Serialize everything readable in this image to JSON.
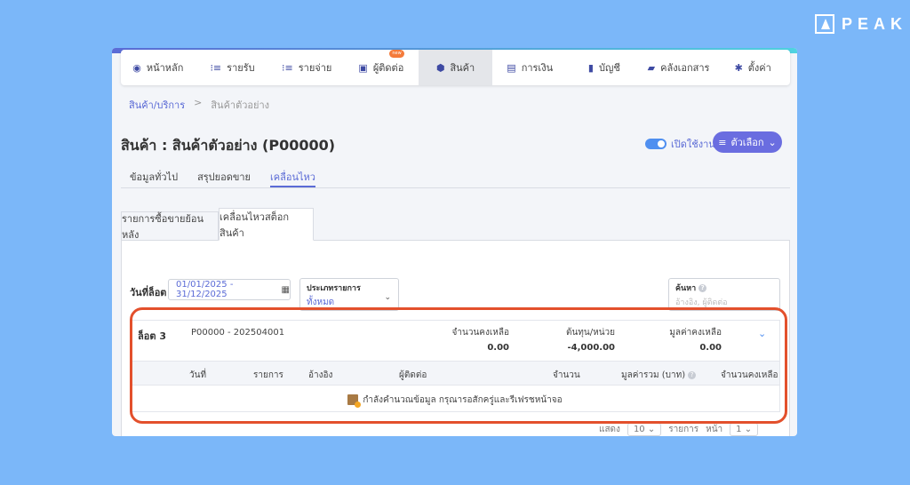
{
  "brand": {
    "name": "PEAK"
  },
  "nav": [
    {
      "label": "หน้าหลัก",
      "icon": "◉"
    },
    {
      "label": "รายรับ",
      "icon": "⁝≡"
    },
    {
      "label": "รายจ่าย",
      "icon": "⁝≡"
    },
    {
      "label": "ผู้ติดต่อ",
      "icon": "▣",
      "badge": "new"
    },
    {
      "label": "สินค้า",
      "icon": "⬢",
      "active": true
    },
    {
      "label": "การเงิน",
      "icon": "▤"
    },
    {
      "label": "บัญชี",
      "icon": "▮"
    },
    {
      "label": "คลังเอกสาร",
      "icon": "▰"
    },
    {
      "label": "ตั้งค่า",
      "icon": "✱"
    }
  ],
  "breadcrumb": {
    "root": "สินค้า/บริการ",
    "sep": ">",
    "current": "สินค้าตัวอย่าง"
  },
  "page_title": "สินค้า : สินค้าตัวอย่าง (P00000)",
  "toggle_label": "เปิดใช้งาน",
  "options_label": "ตัวเลือก",
  "subtabs": [
    "ข้อมูลทั่วไป",
    "สรุปยอดขาย",
    "เคลื่อนไหว"
  ],
  "card_tabs": [
    "รายการซื้อขายย้อนหลัง",
    "เคลื่อนไหวสต็อกสินค้า"
  ],
  "filters": {
    "date_label": "วันที่ล็อต",
    "date_value": "01/01/2025 - 31/12/2025",
    "type_label": "ประเภทรายการ",
    "type_value": "ทั้งหมด",
    "search_label": "ค้นหา",
    "search_placeholder": "อ้างอิง, ผู้ติดต่อ"
  },
  "lot": {
    "name": "ล็อต 3",
    "code": "P00000 - 202504001",
    "stats": [
      {
        "label": "จำนวนคงเหลือ",
        "value": "0.00"
      },
      {
        "label": "ต้นทุน/หน่วย",
        "value": "-4,000.00"
      },
      {
        "label": "มูลค่าคงเหลือ",
        "value": "0.00"
      }
    ]
  },
  "table_headers": [
    "วันที่",
    "รายการ",
    "อ้างอิง",
    "ผู้ติดต่อ",
    "จำนวน",
    "มูลค่ารวม (บาท)",
    "จำนวนคงเหลือ"
  ],
  "loading_text": "กำลังคำนวณข้อมูล กรุณารอสักครู่และรีเฟรชหน้าจอ",
  "pager": {
    "show_label": "แสดง",
    "per_page": "10",
    "items_label": "รายการ",
    "page_label": "หน้า",
    "page": "1"
  }
}
